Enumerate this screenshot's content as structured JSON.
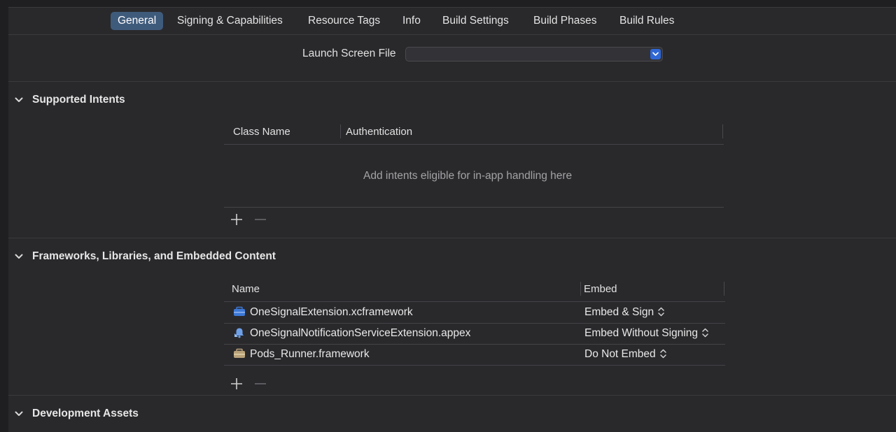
{
  "tabs": [
    {
      "label": "General",
      "active": true
    },
    {
      "label": "Signing & Capabilities",
      "active": false
    },
    {
      "label": "Resource Tags",
      "active": false
    },
    {
      "label": "Info",
      "active": false
    },
    {
      "label": "Build Settings",
      "active": false
    },
    {
      "label": "Build Phases",
      "active": false
    },
    {
      "label": "Build Rules",
      "active": false
    }
  ],
  "launch_screen": {
    "label": "Launch Screen File",
    "value": ""
  },
  "supported_intents": {
    "title": "Supported Intents",
    "columns": [
      "Class Name",
      "Authentication"
    ],
    "empty_message": "Add intents eligible for in-app handling here"
  },
  "frameworks": {
    "title": "Frameworks, Libraries, and Embedded Content",
    "columns": [
      "Name",
      "Embed"
    ],
    "rows": [
      {
        "name": "OneSignalExtension.xcframework",
        "embed": "Embed & Sign",
        "icon": "xcframework-icon"
      },
      {
        "name": "OneSignalNotificationServiceExtension.appex",
        "embed": "Embed Without Signing",
        "icon": "appex-extension-icon"
      },
      {
        "name": "Pods_Runner.framework",
        "embed": "Do Not Embed",
        "icon": "framework-toolbox-icon"
      }
    ]
  },
  "development_assets": {
    "title": "Development Assets"
  },
  "colors": {
    "background": "#29292c",
    "active_tab": "#3f5b7c",
    "popup_accent": "#2f67d6"
  }
}
